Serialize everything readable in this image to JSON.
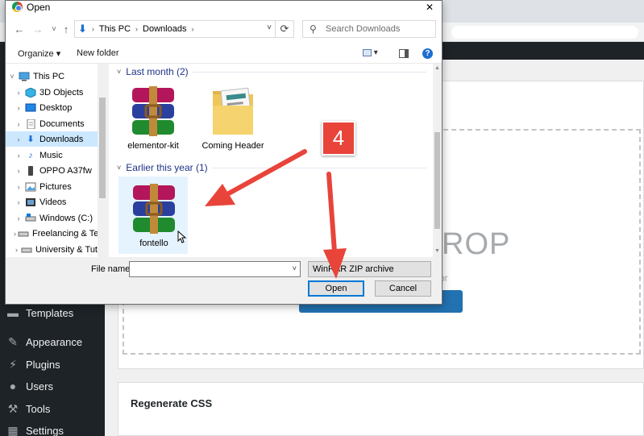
{
  "dialog": {
    "title": "Open",
    "close_glyph": "✕",
    "nav": {
      "back": "←",
      "forward": "→",
      "recent": "˅",
      "up": "↑",
      "refresh": "⟳"
    },
    "breadcrumb": [
      "This PC",
      "Downloads"
    ],
    "search_placeholder": "Search Downloads",
    "toolbar": {
      "organize": "Organize ▾",
      "new_folder": "New folder",
      "help": "?"
    },
    "nav_pane": {
      "items": [
        {
          "label": "This PC",
          "icon": "pc-icon"
        },
        {
          "label": "3D Objects",
          "icon": "cube-icon"
        },
        {
          "label": "Desktop",
          "icon": "desktop-icon"
        },
        {
          "label": "Documents",
          "icon": "documents-icon"
        },
        {
          "label": "Downloads",
          "icon": "download-icon",
          "selected": true
        },
        {
          "label": "Music",
          "icon": "music-icon"
        },
        {
          "label": "OPPO A37fw",
          "icon": "phone-icon"
        },
        {
          "label": "Pictures",
          "icon": "pictures-icon"
        },
        {
          "label": "Videos",
          "icon": "videos-icon"
        },
        {
          "label": "Windows (C:)",
          "icon": "drive-icon"
        },
        {
          "label": "Freelancing & Te",
          "icon": "drive-icon"
        },
        {
          "label": "University & Tut",
          "icon": "drive-icon"
        }
      ]
    },
    "groups": [
      {
        "label": "Last month (2)",
        "files": [
          "elementor-kit",
          "Coming Header"
        ]
      },
      {
        "label": "Earlier this year (1)",
        "files": [
          "fontello"
        ]
      }
    ],
    "file_name_label": "File name:",
    "file_name_value": "",
    "file_type": "WinRAR ZIP archive",
    "open_label": "Open",
    "cancel_label": "Cancel"
  },
  "wp": {
    "menu": [
      "Templates",
      "Appearance",
      "Plugins",
      "Users",
      "Tools",
      "Settings"
    ],
    "drop_text": "ROP",
    "drop_sub": "or",
    "regen_title": "Regenerate CSS"
  },
  "annotation": {
    "step": "4",
    "color": "#e8443a"
  },
  "colors": {
    "accent": "#0078d7",
    "selected": "#cce8ff",
    "group_header": "#1e3287",
    "wp_sidebar": "#1d2327",
    "wp_button": "#2271b1"
  }
}
